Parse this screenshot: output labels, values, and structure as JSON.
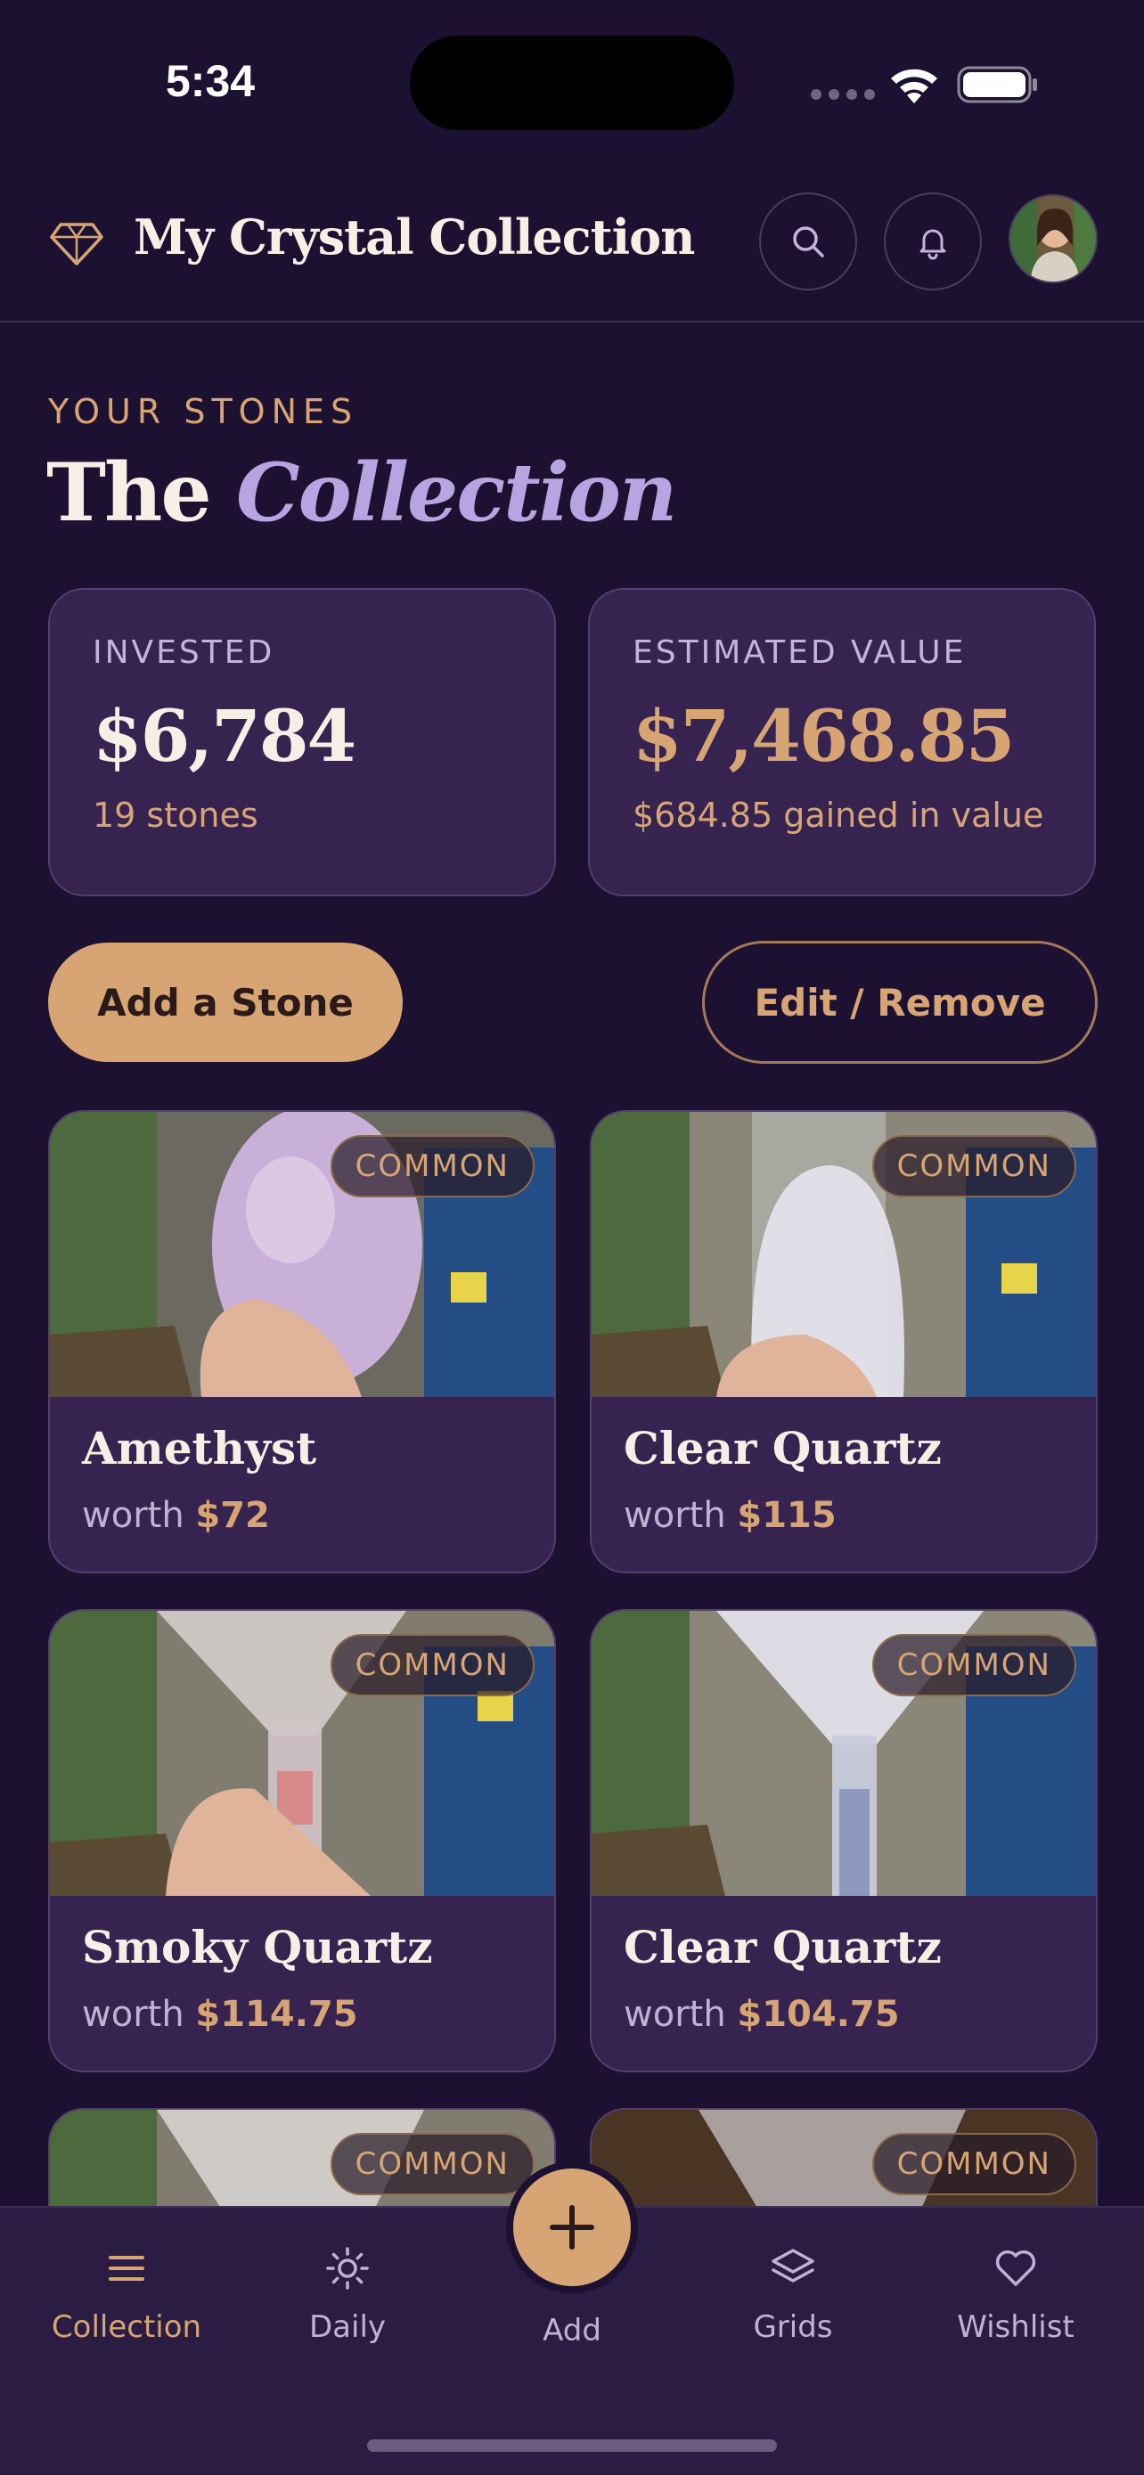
{
  "status_bar": {
    "time": "5:34"
  },
  "header": {
    "title": "My Crystal Collection",
    "icons": [
      "gem-icon",
      "search-icon",
      "bell-icon",
      "avatar"
    ]
  },
  "section": {
    "eyebrow": "YOUR STONES",
    "title_plain": "The",
    "title_accent": "Collection"
  },
  "stats": {
    "invested": {
      "label": "INVESTED",
      "value": "$6,784",
      "sub": "19 stones"
    },
    "estimated": {
      "label": "ESTIMATED VALUE",
      "value": "$7,468.85",
      "sub": "$684.85 gained in value"
    }
  },
  "actions": {
    "add_label": "Add a Stone",
    "edit_label": "Edit / Remove"
  },
  "stones": [
    {
      "name": "Amethyst",
      "worth_prefix": "worth",
      "worth": "$72",
      "rarity": "COMMON"
    },
    {
      "name": "Clear Quartz",
      "worth_prefix": "worth",
      "worth": "$115",
      "rarity": "COMMON"
    },
    {
      "name": "Smoky Quartz",
      "worth_prefix": "worth",
      "worth": "$114.75",
      "rarity": "COMMON"
    },
    {
      "name": "Clear Quartz",
      "worth_prefix": "worth",
      "worth": "$104.75",
      "rarity": "COMMON"
    },
    {
      "name": "",
      "worth_prefix": "",
      "worth": "",
      "rarity": "COMMON"
    },
    {
      "name": "",
      "worth_prefix": "",
      "worth": "",
      "rarity": "COMMON"
    }
  ],
  "nav": {
    "collection": "Collection",
    "daily": "Daily",
    "add": "Add",
    "grids": "Grids",
    "wishlist": "Wishlist"
  },
  "colors": {
    "background": "#1c1130",
    "card": "#37234f",
    "accent_gold": "#d7a574",
    "accent_lavender": "#b7a4e0"
  }
}
